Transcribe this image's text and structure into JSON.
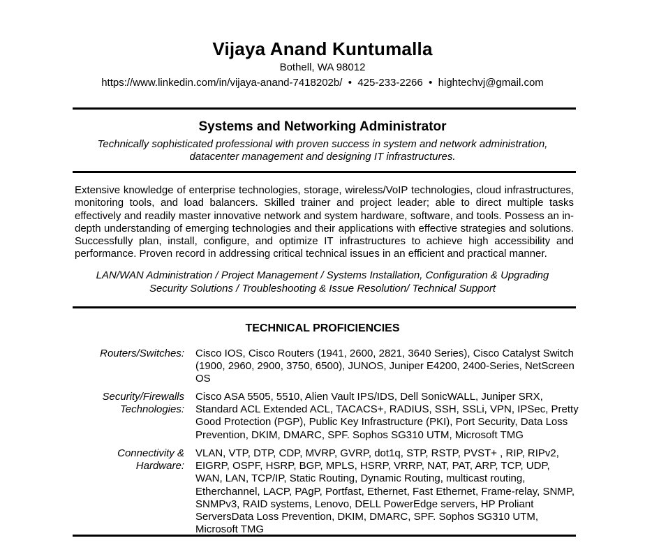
{
  "header": {
    "name": "Vijaya Anand Kuntumalla",
    "location": "Bothell, WA 98012",
    "contact": "https://www.linkedin.com/in/vijaya-anand-7418202b/  •  425-233-2266  •  hightechvj@gmail.com"
  },
  "profile": {
    "title": "Systems and Networking Administrator",
    "tagline": [
      "Technically sophisticated professional with proven success in system and network administration,",
      "datacenter management and designing IT infrastructures."
    ],
    "summary": "Extensive knowledge of enterprise technologies, storage, wireless/VoIP technologies, cloud infrastructures, monitoring tools, and load balancers. Skilled trainer and project leader; able to direct multiple tasks effectively and readily master innovative network and system hardware, software, and tools. Possess an in-depth understanding of emerging technologies and their applications with effective strategies and solutions. Successfully plan, install, configure, and optimize IT infrastructures to achieve high accessibility and performance. Proven record in addressing critical technical issues in an efficient and practical manner.",
    "skills": [
      "LAN/WAN Administration / Project Management / Systems Installation, Configuration & Upgrading",
      "Security Solutions / Troubleshooting & Issue Resolution/ Technical Support"
    ]
  },
  "technical": {
    "heading": "TECHNICAL PROFICIENCIES",
    "items": [
      {
        "label": [
          "Routers/Switches:"
        ],
        "value": "Cisco IOS, Cisco Routers (1941, 2600, 2821, 3640 Series), Cisco Catalyst Switch (1900, 2960, 2900, 3750, 6500), JUNOS, Juniper E4200, 2400-Series, NetScreen OS"
      },
      {
        "label": [
          "Security/Firewalls",
          "Technologies:"
        ],
        "value": "Cisco ASA 5505, 5510, Alien Vault IPS/IDS, Dell SonicWALL, Juniper SRX, Standard ACL Extended ACL, TACACS+, RADIUS, SSH, SSLi, VPN, IPSec, Pretty Good Protection (PGP), Public Key Infrastructure (PKI), Port Security, Data Loss Prevention, DKIM, DMARC, SPF. Sophos SG310 UTM, Microsoft TMG"
      },
      {
        "label": [
          "Connectivity &",
          "Hardware:"
        ],
        "value": "VLAN, VTP, DTP, CDP, MVRP, GVRP, dot1q, STP, RSTP, PVST+ , RIP, RIPv2, EIGRP, OSPF, HSRP, BGP, MPLS, HSRP, VRRP, NAT, PAT, ARP, TCP, UDP, WAN, LAN, TCP/IP, Static Routing, Dynamic Routing, multicast routing, Etherchannel, LACP, PAgP, Portfast, Ethernet, Fast Ethernet, Frame-relay, SNMP, SNMPv3, RAID systems, Lenovo, DELL PowerEdge servers, HP Proliant ServersData Loss Prevention, DKIM, DMARC, SPF. Sophos SG310 UTM, Microsoft TMG"
      }
    ]
  }
}
